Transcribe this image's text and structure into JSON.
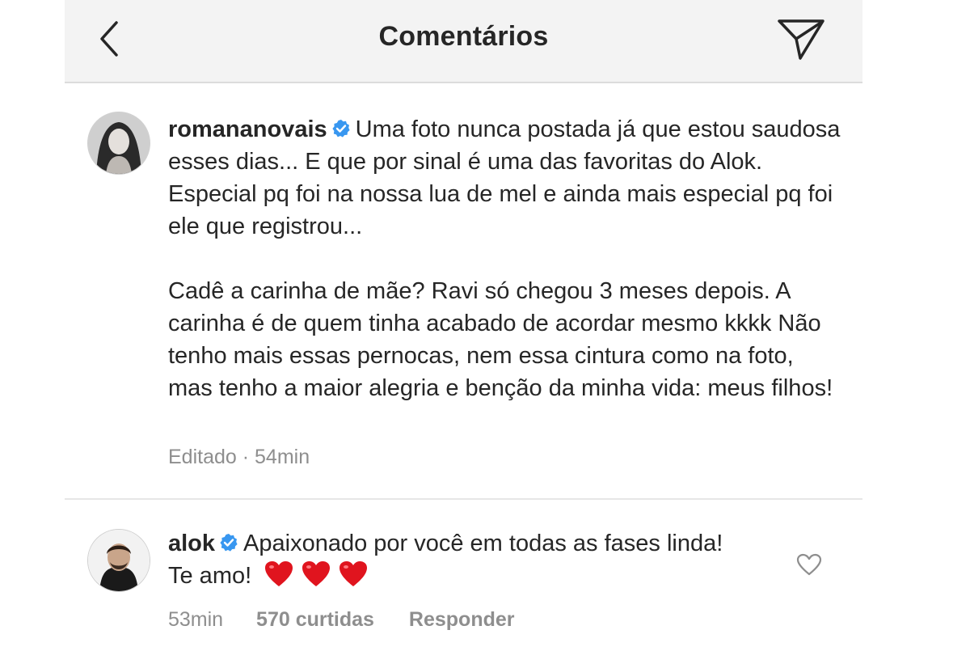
{
  "header": {
    "title": "Comentários"
  },
  "caption": {
    "username": "romananovais",
    "paragraph1": "Uma foto nunca postada já que estou saudosa esses dias... E que por sinal é uma das favoritas do Alok. Especial pq foi na nossa lua de mel e ainda mais especial pq foi ele que registrou...",
    "paragraph2": "Cadê a carinha de mãe?  Ravi só chegou 3 meses depois. A carinha é de quem tinha acabado de acordar mesmo kkkk Não tenho mais essas pernocas, nem essa cintura como na foto, mas tenho a maior alegria e benção da minha vida: meus filhos!",
    "edited_label": "Editado",
    "separator": "·",
    "time": "54min"
  },
  "reply": {
    "username": "alok",
    "text": "Apaixonado por você em todas as fases linda! Te amo!",
    "time": "53min",
    "likes": "570 curtidas",
    "reply_label": "Responder"
  },
  "icons": {
    "back": "chevron-left-icon",
    "send": "paper-plane-icon",
    "verified": "verified-badge-icon",
    "like": "heart-outline-icon",
    "emoji": "red-heart-emoji"
  },
  "colors": {
    "verified_blue": "#3897f0",
    "heart_red": "#e0141e",
    "meta_gray": "#8e8e8e"
  }
}
